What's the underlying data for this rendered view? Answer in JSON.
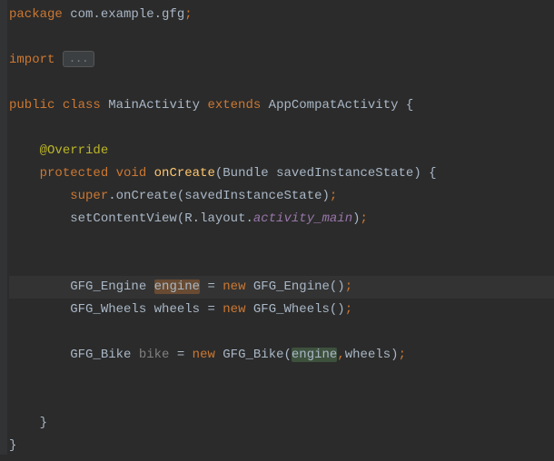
{
  "code": {
    "package_kw": "package",
    "package_name": " com.example.gfg",
    "import_kw": "import",
    "import_fold": "...",
    "public_kw": "public ",
    "class_kw": "class ",
    "class_name": "MainActivity ",
    "extends_kw": "extends ",
    "super_class": "AppCompatActivity ",
    "brace_open": "{",
    "brace_close": "}",
    "annotation": "@Override",
    "protected_kw": "protected ",
    "void_kw": "void ",
    "method_name": "onCreate",
    "param_type": "Bundle ",
    "param_name": "savedInstanceState",
    "super_kw": "super",
    "dot": ".",
    "oncreate_call": "onCreate",
    "arg1": "savedInstanceState",
    "setcontent": "setContentView",
    "r": "R",
    "layout": "layout",
    "activity_main": "activity_main",
    "engine_type": "GFG_Engine ",
    "engine_var": "engine",
    "eq": " = ",
    "new_kw": "new ",
    "engine_ctor": "GFG_Engine",
    "empty_parens": "()",
    "wheels_type": "GFG_Wheels ",
    "wheels_var": "wheels",
    "wheels_ctor": "GFG_Wheels",
    "bike_type": "GFG_Bike ",
    "bike_var": "bike",
    "bike_ctor": "GFG_Bike",
    "bike_arg1": "engine",
    "comma": ",",
    "bike_arg2": "wheels",
    "semi": ";"
  }
}
